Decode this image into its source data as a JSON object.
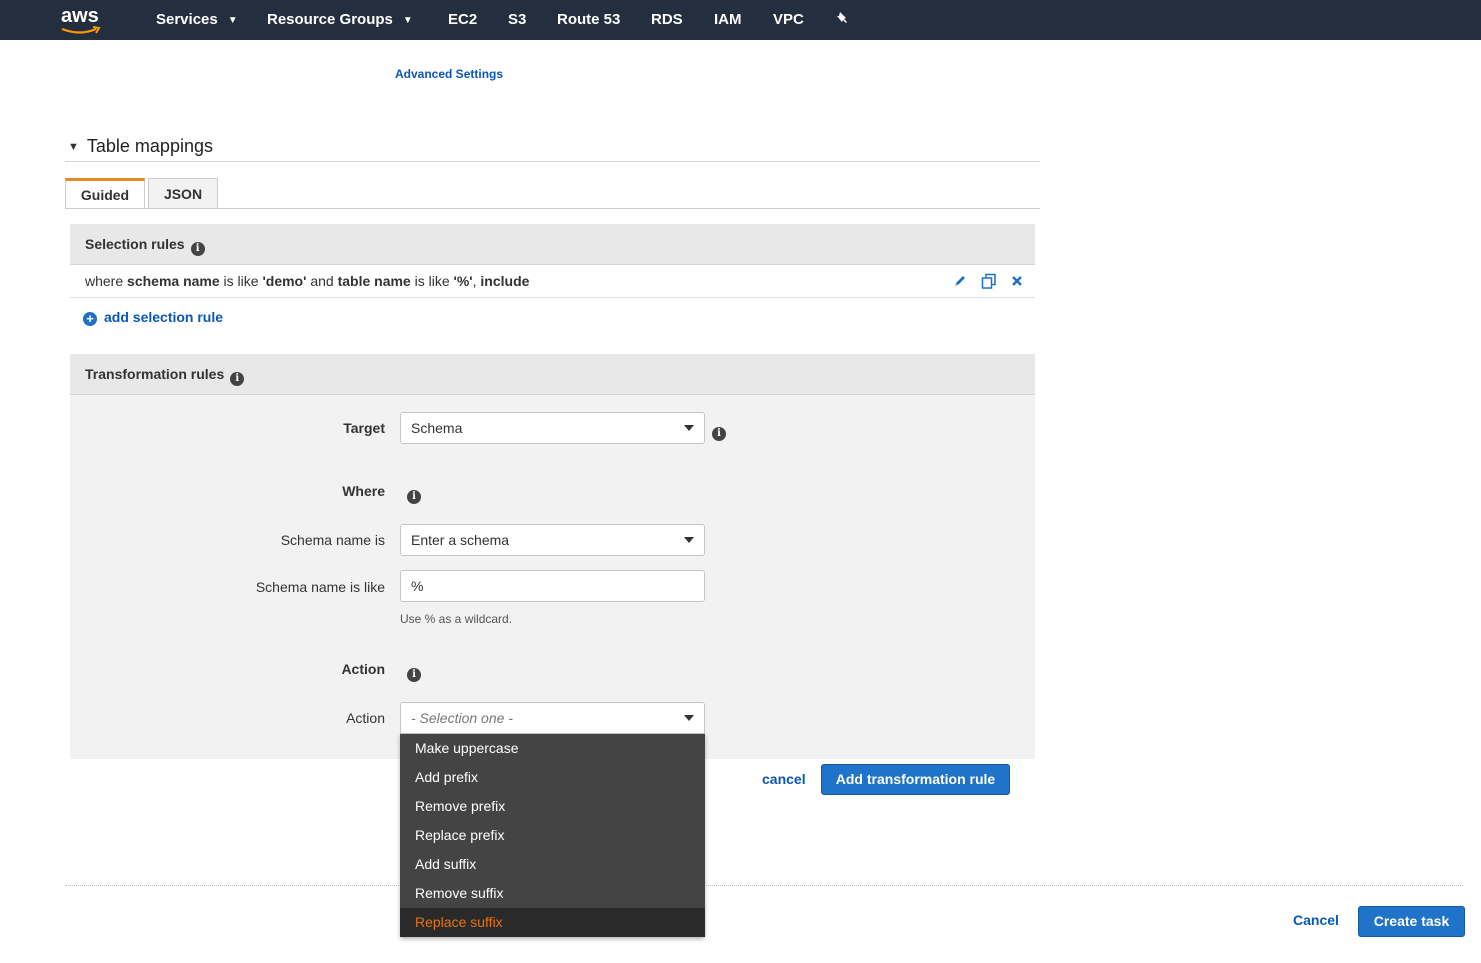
{
  "nav": {
    "logo": "aws",
    "items": [
      {
        "label": "Services",
        "dropdown": true
      },
      {
        "label": "Resource Groups",
        "dropdown": true
      },
      {
        "label": "EC2"
      },
      {
        "label": "S3"
      },
      {
        "label": "Route 53"
      },
      {
        "label": "RDS"
      },
      {
        "label": "IAM"
      },
      {
        "label": "VPC"
      }
    ],
    "pin_icon": "pin-icon"
  },
  "advanced_settings": "Advanced Settings",
  "table_mappings": {
    "title": "Table mappings",
    "tabs": [
      "Guided",
      "JSON"
    ],
    "active_tab": "Guided"
  },
  "selection_rules": {
    "title": "Selection rules",
    "rule": {
      "where": "where ",
      "schema_label": "schema name",
      "is_like": " is like ",
      "schema_value": "'demo'",
      "and": " and ",
      "table_label": "table name",
      "is_like2": " is like ",
      "table_value": "'%'",
      "comma": ", ",
      "action": "include"
    },
    "add_label": "add selection rule"
  },
  "transformation_rules": {
    "title": "Transformation rules",
    "target_label": "Target",
    "target_value": "Schema",
    "where_label": "Where",
    "schema_name_is_label": "Schema name is",
    "schema_name_is_value": "Enter a schema",
    "schema_name_like_label": "Schema name is like",
    "schema_name_like_value": "%",
    "wildcard_hint": "Use % as a wildcard.",
    "action_heading": "Action",
    "action_label": "Action",
    "action_placeholder": "- Selection one -",
    "action_options": [
      "Make uppercase",
      "Add prefix",
      "Remove prefix",
      "Replace prefix",
      "Add suffix",
      "Remove suffix",
      "Replace suffix"
    ],
    "highlighted_option": "Replace suffix",
    "cancel_label": "cancel",
    "add_button": "Add transformation rule"
  },
  "footer": {
    "cancel_label": "Cancel",
    "create_label": "Create task"
  },
  "colors": {
    "nav_bg": "#232f3e",
    "link_blue": "#0b57b5",
    "primary_button": "#1f73c9",
    "tab_accent": "#e7891e",
    "highlight_orange": "#ec7211"
  }
}
